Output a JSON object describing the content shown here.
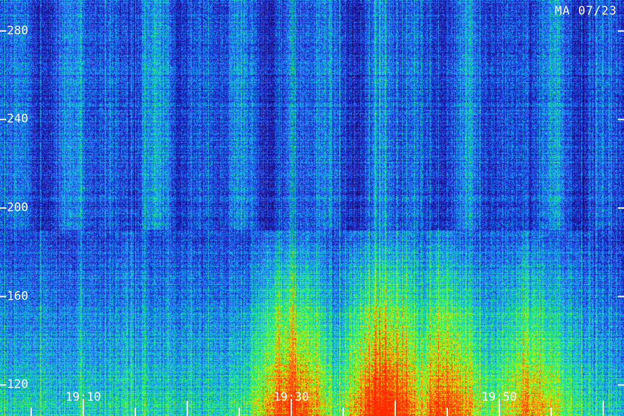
{
  "stamp": "MA 07/23",
  "chart_data": {
    "type": "heatmap",
    "title": "",
    "xlabel": "",
    "ylabel": "",
    "grid": false,
    "colormap": [
      "#000010",
      "#1a0a6e",
      "#2020c8",
      "#1e7cff",
      "#12d2c8",
      "#3cff3c",
      "#ffe600",
      "#ff2a00"
    ],
    "y_ticks": [
      120,
      160,
      200,
      240,
      280
    ],
    "ylim": [
      106,
      294
    ],
    "x_ticks": [
      "19:10",
      "19:30",
      "19:50"
    ],
    "x_tick_minutes": [
      10,
      30,
      50
    ],
    "xlim_minutes": [
      2,
      62
    ],
    "intensity_profile": {
      "description_free_hotspots_minutes": [
        30,
        39,
        45,
        53
      ],
      "hotspot_strengths": [
        0.85,
        1.0,
        0.8,
        0.6
      ],
      "low_band_y_max": 190,
      "peak_minute": 39,
      "peak_y": 108
    }
  }
}
